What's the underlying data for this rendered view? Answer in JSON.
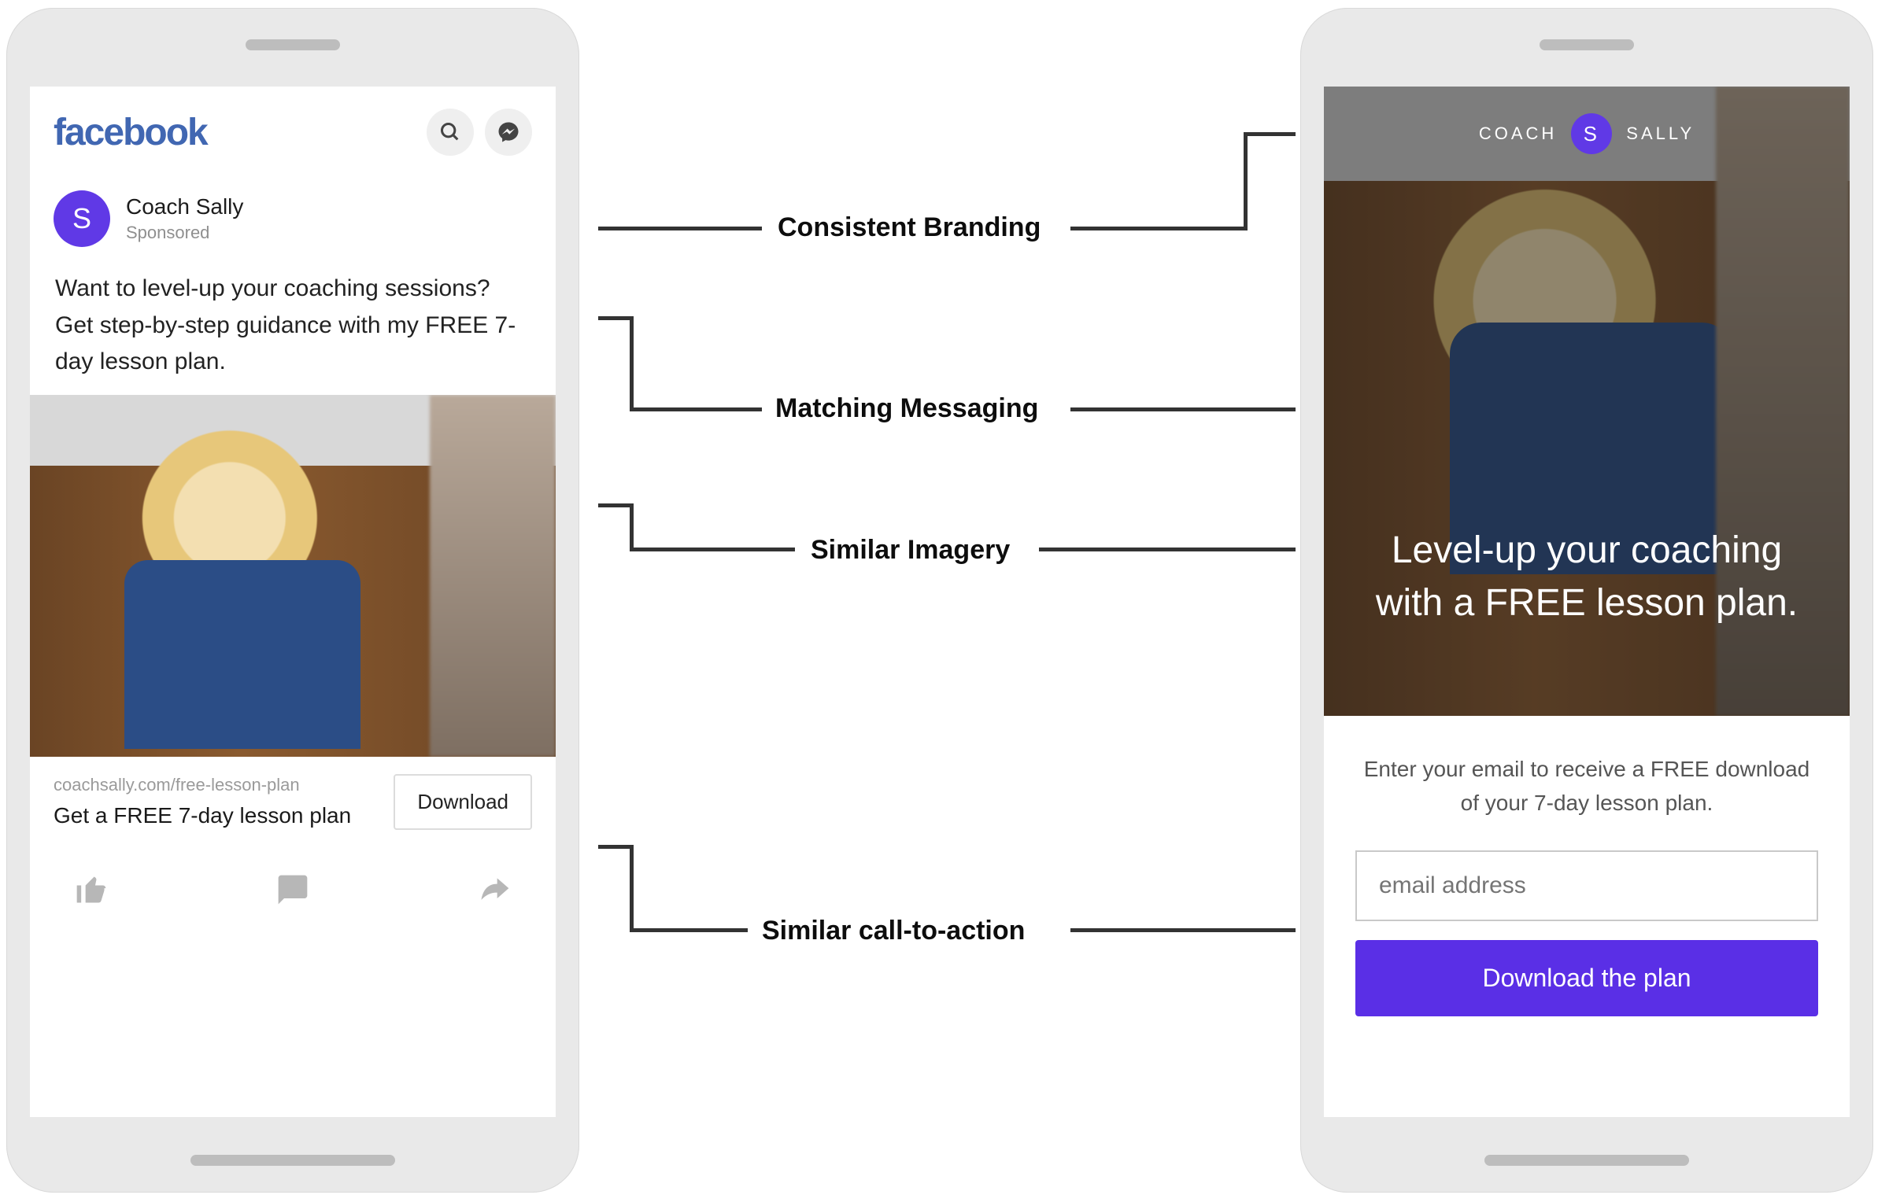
{
  "left": {
    "facebook_logo": "facebook",
    "avatar_letter": "S",
    "page_name": "Coach Sally",
    "sponsored": "Sponsored",
    "post_text": "Want to level-up your coaching sessions? Get step-by-step guidance with my FREE 7-day lesson plan.",
    "link_url": "coachsally.com/free-lesson-plan",
    "link_title": "Get a FREE 7-day lesson plan",
    "download_button": "Download"
  },
  "right": {
    "brand_first": "COACH",
    "brand_letter": "S",
    "brand_last": "SALLY",
    "headline": "Level-up your coaching with a FREE lesson plan.",
    "instruction": "Enter your email to receive a FREE download of your 7-day lesson plan.",
    "email_placeholder": "email address",
    "cta_label": "Download the plan"
  },
  "annotations": {
    "branding": "Consistent Branding",
    "messaging": "Matching Messaging",
    "imagery": "Similar Imagery",
    "cta": "Similar call-to-action"
  },
  "colors": {
    "accent_purple": "#5a2fe6",
    "facebook_blue": "#4167b2"
  }
}
